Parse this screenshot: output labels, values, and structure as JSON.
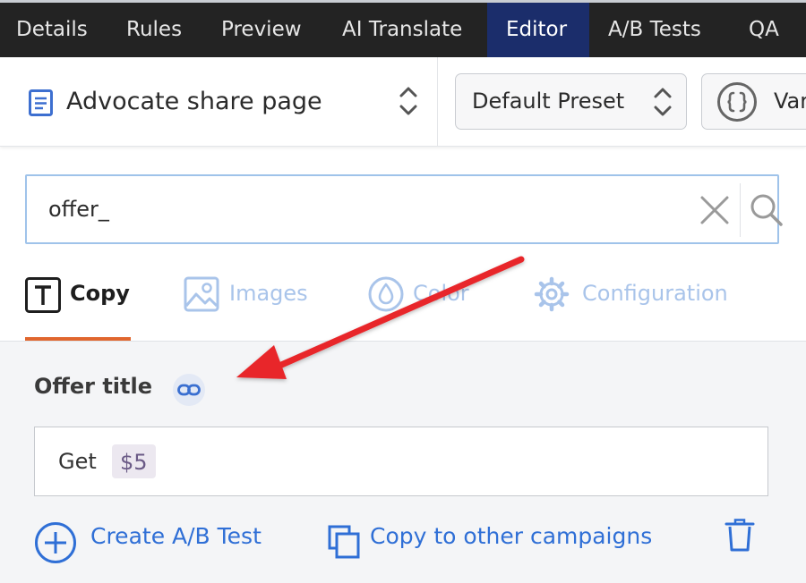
{
  "topnav": {
    "tabs": [
      {
        "label": "Details"
      },
      {
        "label": "Rules"
      },
      {
        "label": "Preview"
      },
      {
        "label": "AI Translate"
      },
      {
        "label": "Editor"
      },
      {
        "label": "A/B Tests"
      },
      {
        "label": "QA"
      }
    ],
    "active_tab": "Editor",
    "background": "#232323",
    "active_background": "#1b2d6b"
  },
  "subheader": {
    "page_title": "Advocate share page",
    "preset_label": "Default Preset",
    "variables_label": "Var"
  },
  "search": {
    "value": "offer_",
    "clear_icon": "close-icon",
    "search_icon": "search-icon"
  },
  "category_tabs": [
    {
      "label": "Copy",
      "icon": "text-icon",
      "active": true
    },
    {
      "label": "Images",
      "icon": "image-icon",
      "active": false
    },
    {
      "label": "Color",
      "icon": "droplet-icon",
      "active": false
    },
    {
      "label": "Configuration",
      "icon": "gear-icon",
      "active": false
    }
  ],
  "field": {
    "label": "Offer title",
    "link_icon": "link-icon",
    "text_prefix": "Get",
    "token": "$5"
  },
  "actions": {
    "create_ab_test": "Create A/B Test",
    "copy_to_campaigns": "Copy to other campaigns"
  },
  "colors": {
    "accent_blue": "#2f6fd6",
    "tab_underline": "#e0662e",
    "annotation_arrow": "#e8262b"
  }
}
